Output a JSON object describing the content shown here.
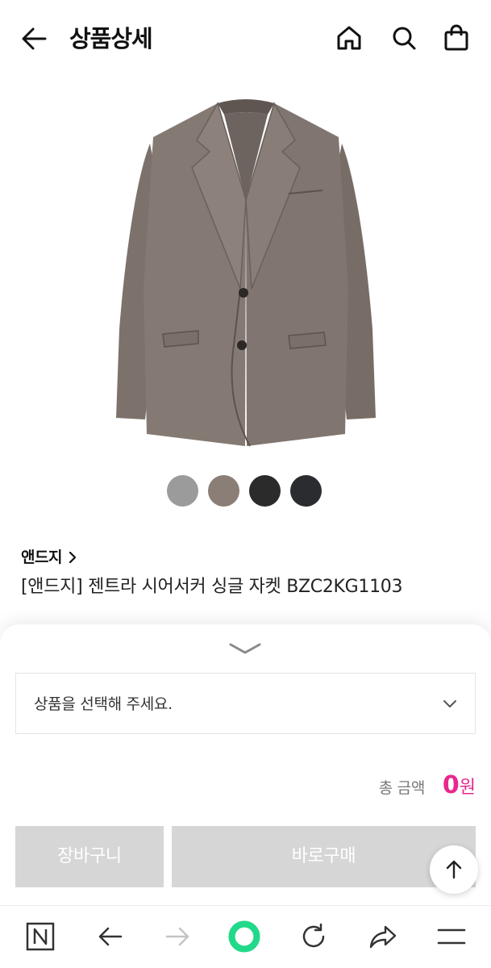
{
  "header": {
    "title": "상품상세",
    "icons": [
      "back-arrow-icon",
      "home-icon",
      "search-icon",
      "shopping-bag-icon"
    ]
  },
  "product": {
    "image": "gray-blazer-photo",
    "swatch_colors": [
      "#9b9b9b",
      "#8a7e77",
      "#2b2b2b",
      "#2a2c30"
    ],
    "brand": "앤드지",
    "name": "[앤드지] 젠트라 시어서커 싱글 자켓 BZC2KG1103"
  },
  "sheet": {
    "option_placeholder": "상품을 선택해 주세요.",
    "total_label": "총 금액",
    "total_amount": "0",
    "total_unit": "원",
    "cart_button": "장바구니",
    "buy_button": "바로구매"
  },
  "colors": {
    "accent": "#e8288c",
    "disabled_button": "#d6d6d6",
    "browser_green": "#22d98a"
  },
  "browser_bar": {
    "icons": [
      "naver-n-icon",
      "back-icon",
      "forward-icon",
      "green-dot-icon",
      "refresh-icon",
      "share-icon",
      "menu-icon"
    ]
  }
}
